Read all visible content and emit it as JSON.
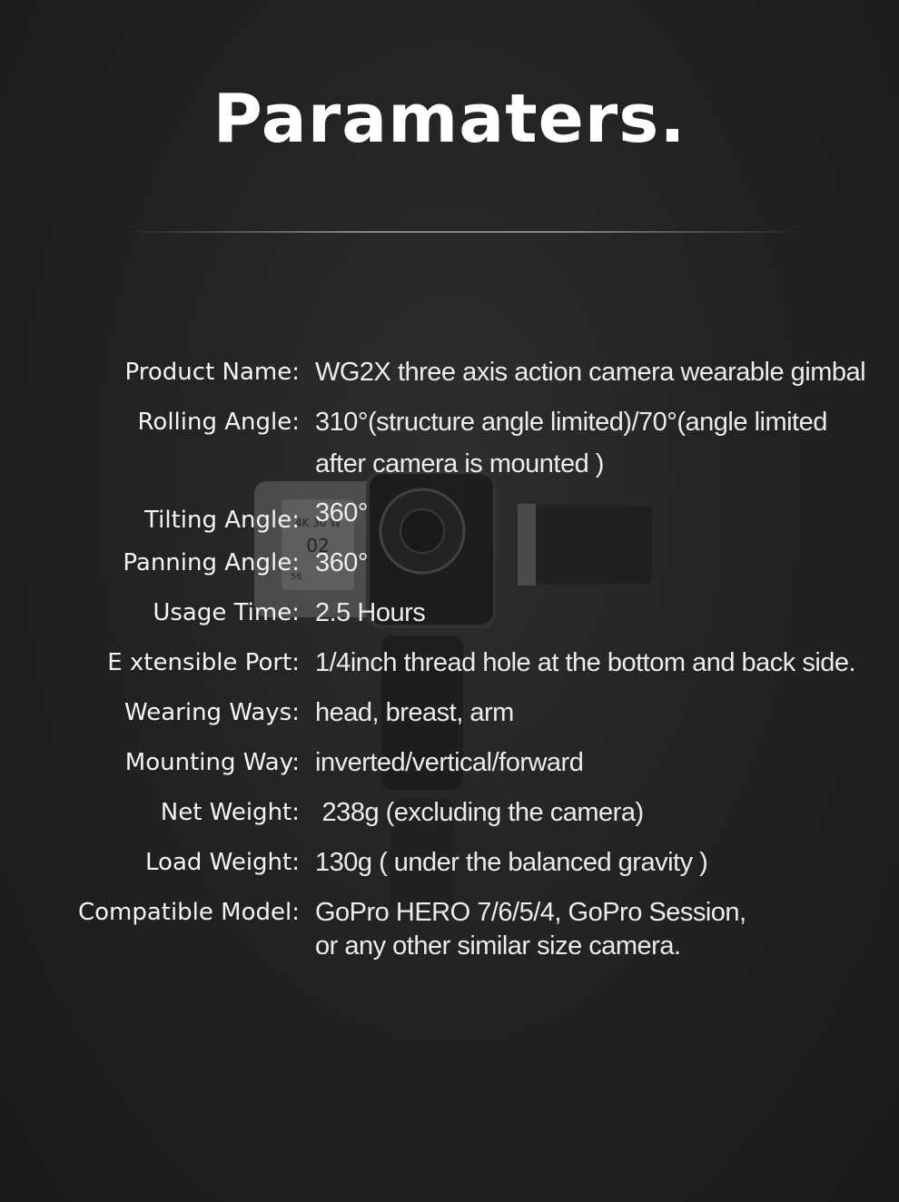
{
  "title": "Paramaters.",
  "specs": [
    {
      "label": "Product Name:",
      "lines": [
        "WG2X three axis action camera wearable gimbal"
      ]
    },
    {
      "label": "Rolling Angle:",
      "lines": [
        "310°(structure angle limited)/70°(angle limited",
        "after camera is mounted )"
      ]
    },
    {
      "label": "Tilting Angle:",
      "lines": [
        "360°"
      ]
    },
    {
      "label": "Panning Angle:",
      "lines": [
        "360°"
      ]
    },
    {
      "label": "Usage Time:",
      "lines": [
        "2.5 Hours"
      ]
    },
    {
      "label": "E xtensible Port:",
      "lines": [
        "1/4inch thread hole at the bottom and back side."
      ]
    },
    {
      "label": "Wearing Ways:",
      "lines": [
        "head, breast, arm"
      ]
    },
    {
      "label": "Mounting Way:",
      "lines": [
        "inverted/vertical/forward"
      ]
    },
    {
      "label": "Net Weight:",
      "lines": [
        " 238g (excluding the camera)"
      ]
    },
    {
      "label": "Load Weight:",
      "lines": [
        "130g ( under the balanced gravity )"
      ]
    },
    {
      "label": "Compatible Model:",
      "lines": [
        "GoPro HERO 7/6/5/4, GoPro Session,",
        "or any other similar size camera."
      ]
    }
  ],
  "camera_screen": {
    "line1": "4K 30 W",
    "line2": "02",
    "line3": "56"
  }
}
